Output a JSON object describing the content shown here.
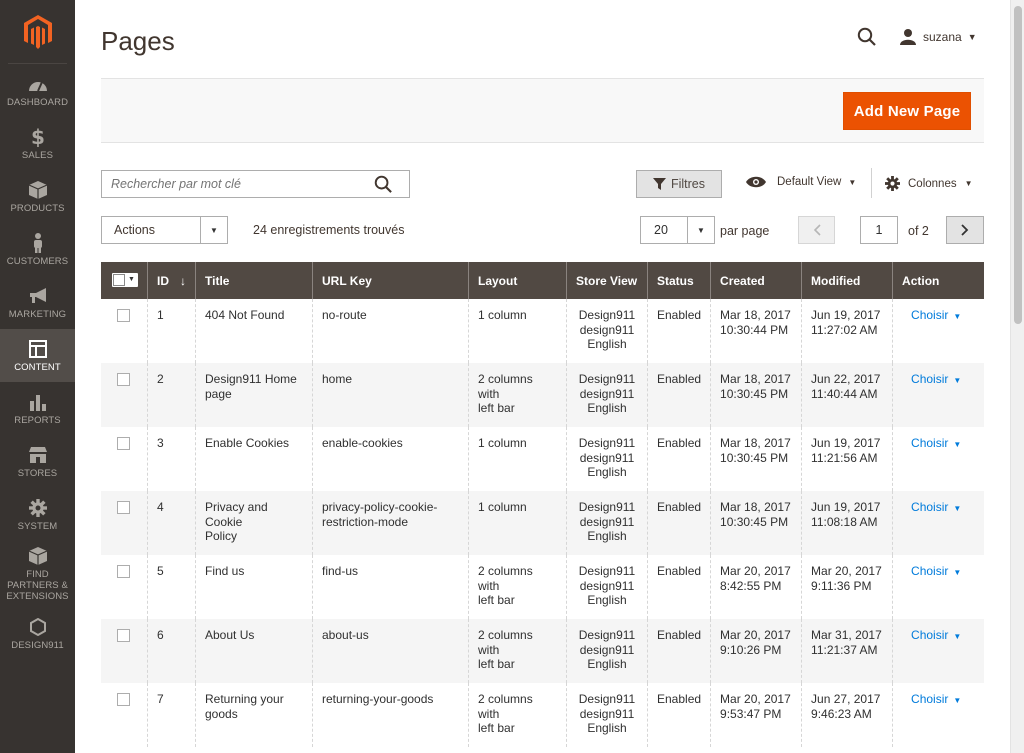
{
  "sidebar": {
    "items": [
      {
        "label": "DASHBOARD",
        "icon": "dashboard-icon"
      },
      {
        "label": "SALES",
        "icon": "dollar-icon"
      },
      {
        "label": "PRODUCTS",
        "icon": "box-icon"
      },
      {
        "label": "CUSTOMERS",
        "icon": "person-icon"
      },
      {
        "label": "MARKETING",
        "icon": "megaphone-icon"
      },
      {
        "label": "CONTENT",
        "icon": "layout-icon",
        "active": true
      },
      {
        "label": "REPORTS",
        "icon": "bar-chart-icon"
      },
      {
        "label": "STORES",
        "icon": "store-icon"
      },
      {
        "label": "SYSTEM",
        "icon": "gear-icon"
      },
      {
        "label": "FIND PARTNERS & EXTENSIONS",
        "icon": "cube-icon"
      },
      {
        "label": "DESIGN911",
        "icon": "hexagon-icon"
      }
    ]
  },
  "header": {
    "title": "Pages",
    "user_name": "suzana"
  },
  "actions": {
    "add_new_label": "Add New Page"
  },
  "toolbar": {
    "search_placeholder": "Rechercher par mot clé",
    "filters_label": "Filtres",
    "view_label": "Default View",
    "columns_label": "Colonnes",
    "mass_action_label": "Actions",
    "records_found": "24 enregistrements trouvés",
    "per_page_value": "20",
    "per_page_label": "par page",
    "current_page": "1",
    "of_pages": "of 2"
  },
  "table": {
    "columns": [
      "ID",
      "Title",
      "URL Key",
      "Layout",
      "Store View",
      "Status",
      "Created",
      "Modified",
      "Action"
    ],
    "rows": [
      {
        "id": "1",
        "title": [
          "404 Not Found"
        ],
        "url": [
          "no-route"
        ],
        "layout": [
          "1 column"
        ],
        "store": [
          "Design911",
          "design911",
          "English"
        ],
        "status": "Enabled",
        "created": [
          "Mar 18, 2017",
          "10:30:44 PM"
        ],
        "modified": [
          "Jun 19, 2017",
          "11:27:02 AM"
        ],
        "action": "Choisir"
      },
      {
        "id": "2",
        "title": [
          "Design911 Home",
          "page"
        ],
        "url": [
          "home"
        ],
        "layout": [
          "2 columns with",
          "left bar"
        ],
        "store": [
          "Design911",
          "design911",
          "English"
        ],
        "status": "Enabled",
        "created": [
          "Mar 18, 2017",
          "10:30:45 PM"
        ],
        "modified": [
          "Jun 22, 2017",
          "11:40:44 AM"
        ],
        "action": "Choisir"
      },
      {
        "id": "3",
        "title": [
          "Enable Cookies"
        ],
        "url": [
          "enable-cookies"
        ],
        "layout": [
          "1 column"
        ],
        "store": [
          "Design911",
          "design911",
          "English"
        ],
        "status": "Enabled",
        "created": [
          "Mar 18, 2017",
          "10:30:45 PM"
        ],
        "modified": [
          "Jun 19, 2017",
          "11:21:56 AM"
        ],
        "action": "Choisir"
      },
      {
        "id": "4",
        "title": [
          "Privacy and Cookie",
          "Policy"
        ],
        "url": [
          "privacy-policy-cookie-",
          "restriction-mode"
        ],
        "layout": [
          "1 column"
        ],
        "store": [
          "Design911",
          "design911",
          "English"
        ],
        "status": "Enabled",
        "created": [
          "Mar 18, 2017",
          "10:30:45 PM"
        ],
        "modified": [
          "Jun 19, 2017",
          "11:08:18 AM"
        ],
        "action": "Choisir"
      },
      {
        "id": "5",
        "title": [
          "Find us"
        ],
        "url": [
          "find-us"
        ],
        "layout": [
          "2 columns with",
          "left bar"
        ],
        "store": [
          "Design911",
          "design911",
          "English"
        ],
        "status": "Enabled",
        "created": [
          "Mar 20, 2017",
          "8:42:55 PM"
        ],
        "modified": [
          "Mar 20, 2017",
          "9:11:36 PM"
        ],
        "action": "Choisir"
      },
      {
        "id": "6",
        "title": [
          "About Us"
        ],
        "url": [
          "about-us"
        ],
        "layout": [
          "2 columns with",
          "left bar"
        ],
        "store": [
          "Design911",
          "design911",
          "English"
        ],
        "status": "Enabled",
        "created": [
          "Mar 20, 2017",
          "9:10:26 PM"
        ],
        "modified": [
          "Mar 31, 2017",
          "11:21:37 AM"
        ],
        "action": "Choisir"
      },
      {
        "id": "7",
        "title": [
          "Returning your",
          "goods"
        ],
        "url": [
          "returning-your-goods"
        ],
        "layout": [
          "2 columns with",
          "left bar"
        ],
        "store": [
          "Design911",
          "design911",
          "English"
        ],
        "status": "Enabled",
        "created": [
          "Mar 20, 2017",
          "9:53:47 PM"
        ],
        "modified": [
          "Jun 27, 2017",
          "9:46:23 AM"
        ],
        "action": "Choisir"
      }
    ]
  },
  "colors": {
    "sidebar_bg": "#373330",
    "accent": "#eb5202",
    "table_header": "#514943",
    "link": "#007bdb"
  }
}
